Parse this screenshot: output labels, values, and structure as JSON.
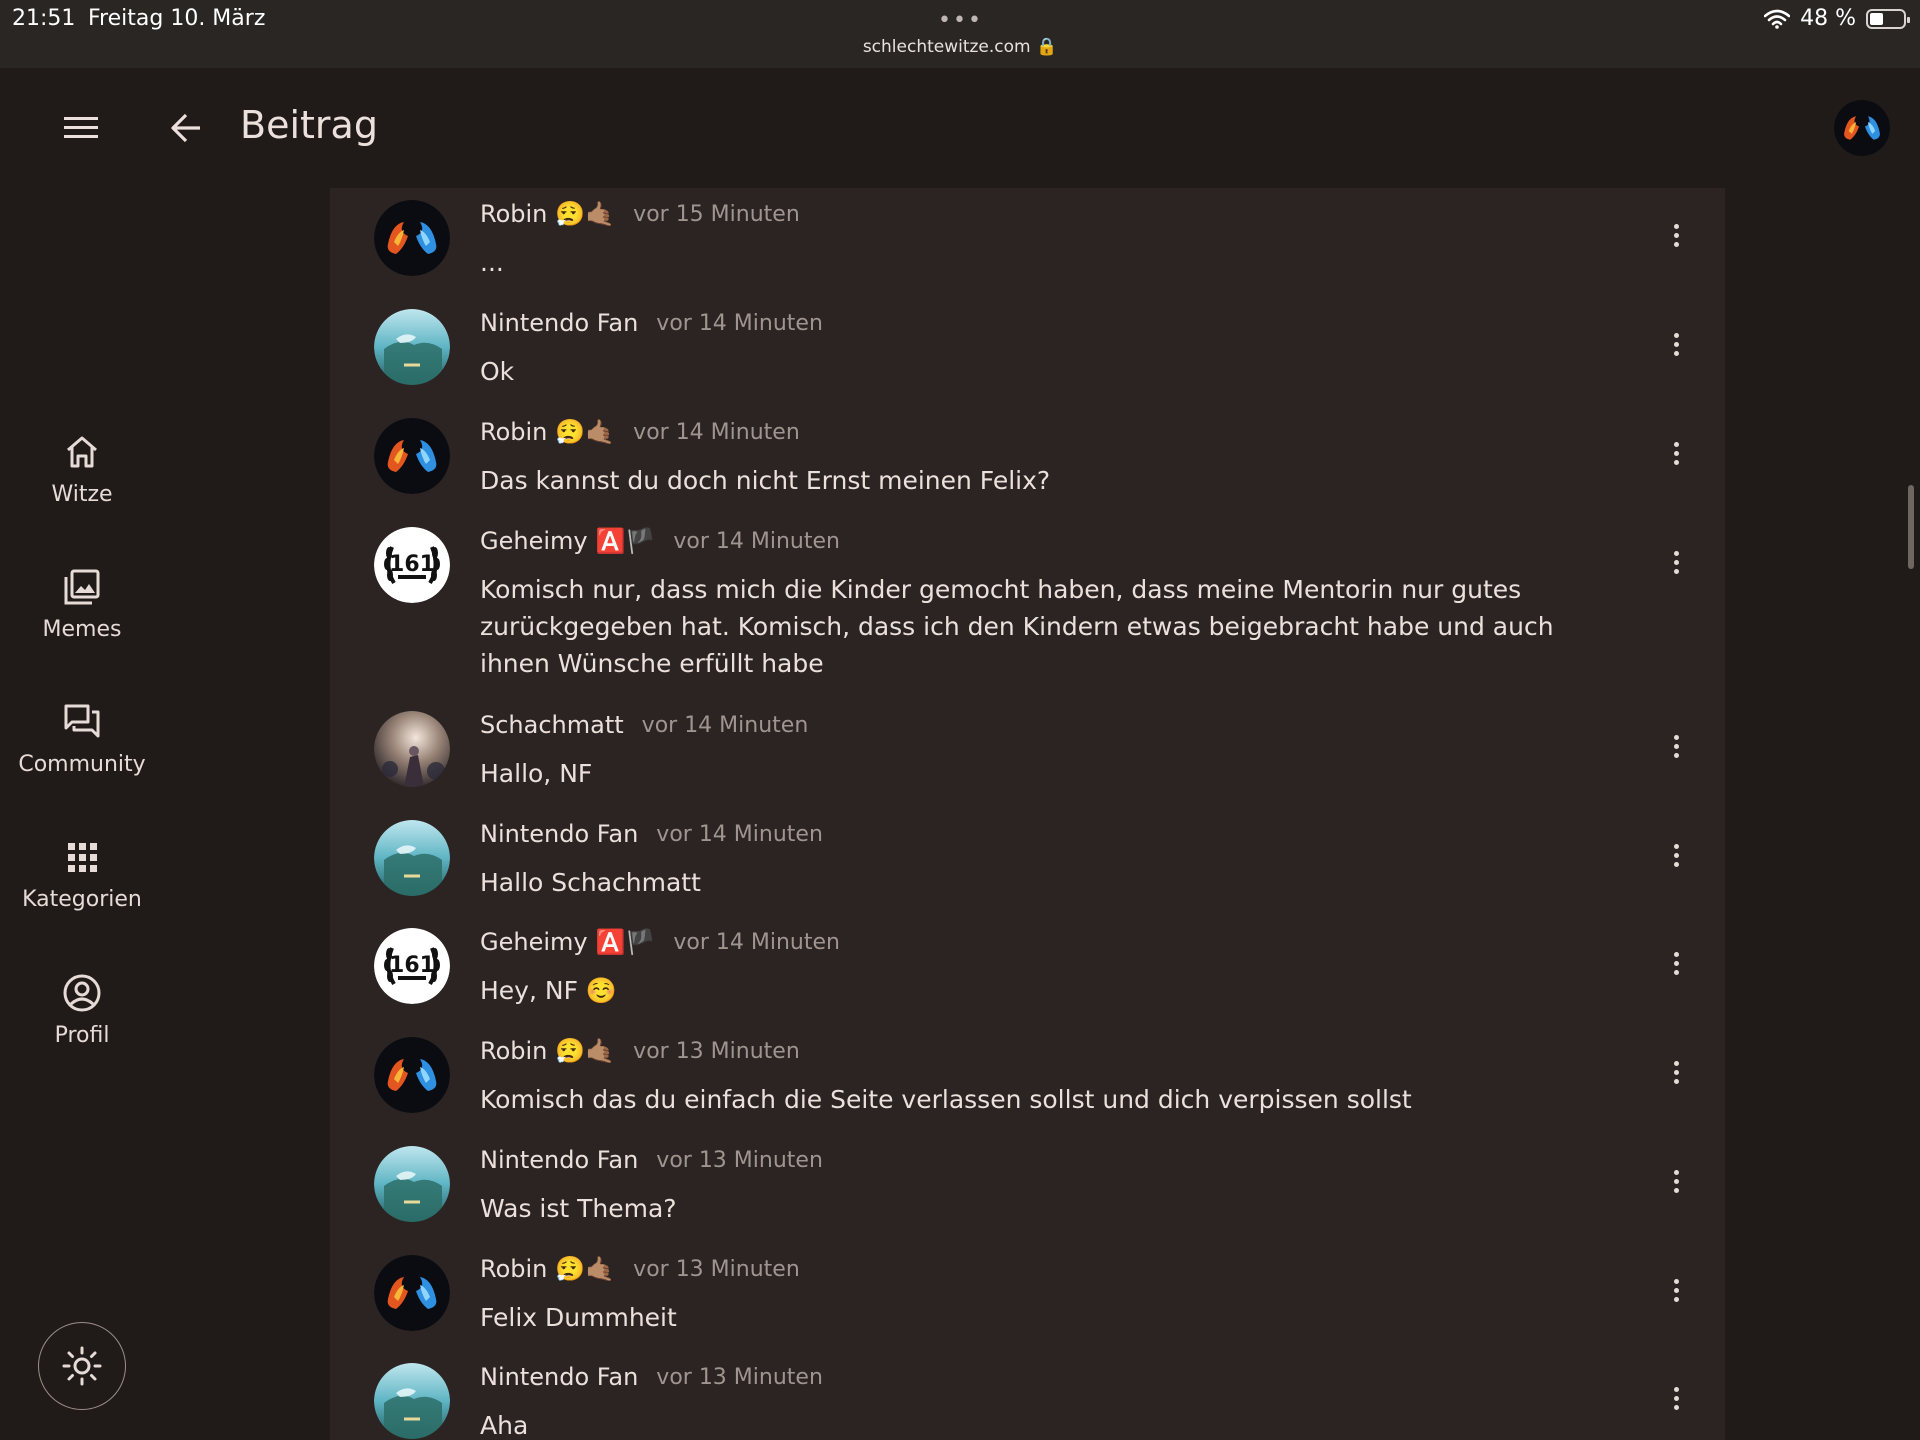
{
  "status_bar": {
    "time": "21:51",
    "date": "Freitag 10. März",
    "dots": "•••",
    "url": "schlechtewitze.com 🔒",
    "battery_text": "48 %",
    "battery_level_percent": 48
  },
  "appbar": {
    "title": "Beitrag",
    "menu_icon": "hamburger-menu-icon",
    "back_icon": "arrow-left-icon",
    "user_avatar": "fire-water-avatar"
  },
  "sidebar": {
    "items": [
      {
        "label": "Witze",
        "icon": "home-icon"
      },
      {
        "label": "Memes",
        "icon": "image-stack-icon"
      },
      {
        "label": "Community",
        "icon": "forum-icon"
      },
      {
        "label": "Kategorien",
        "icon": "grid-apps-icon"
      },
      {
        "label": "Profil",
        "icon": "user-circle-icon"
      }
    ],
    "theme_toggle_icon": "sun-icon"
  },
  "colors": {
    "background": "#201b19",
    "card": "#2c2422",
    "text": "#ece0dc",
    "muted": "#a09490"
  },
  "comments": [
    {
      "author": "Robin",
      "badges": "😮‍💨🤙🏽",
      "time": "vor 15 Minuten",
      "text": "...",
      "avatar": "fire-water"
    },
    {
      "author": "Nintendo Fan",
      "badges": "",
      "time": "vor 14 Minuten",
      "text": "Ok",
      "avatar": "zelda"
    },
    {
      "author": "Robin",
      "badges": "😮‍💨🤙🏽",
      "time": "vor 14 Minuten",
      "text": "Das kannst du doch nicht Ernst meinen Felix?",
      "avatar": "fire-water"
    },
    {
      "author": "Geheimy",
      "badges": "🅰️🏴",
      "time": "vor 14 Minuten",
      "text": "Komisch nur, dass mich die Kinder gemocht haben, dass meine Mentorin nur gutes zurückgegeben hat. Komisch, dass ich den Kindern etwas beigebracht habe und auch ihnen Wünsche erfüllt habe",
      "avatar": "161"
    },
    {
      "author": "Schachmatt",
      "badges": "",
      "time": "vor 14 Minuten",
      "text": "Hallo, NF",
      "avatar": "photo"
    },
    {
      "author": "Nintendo Fan",
      "badges": "",
      "time": "vor 14 Minuten",
      "text": "Hallo Schachmatt",
      "avatar": "zelda"
    },
    {
      "author": "Geheimy",
      "badges": "🅰️🏴",
      "time": "vor 14 Minuten",
      "text": "Hey, NF ☺️",
      "avatar": "161"
    },
    {
      "author": "Robin",
      "badges": "😮‍💨🤙🏽",
      "time": "vor 13 Minuten",
      "text": "Komisch das du einfach die Seite verlassen sollst und dich verpissen sollst",
      "avatar": "fire-water"
    },
    {
      "author": "Nintendo Fan",
      "badges": "",
      "time": "vor 13 Minuten",
      "text": "Was ist Thema?",
      "avatar": "zelda"
    },
    {
      "author": "Robin",
      "badges": "😮‍💨🤙🏽",
      "time": "vor 13 Minuten",
      "text": "Felix Dummheit",
      "avatar": "fire-water"
    },
    {
      "author": "Nintendo Fan",
      "badges": "",
      "time": "vor 13 Minuten",
      "text": "Aha",
      "avatar": "zelda"
    }
  ]
}
